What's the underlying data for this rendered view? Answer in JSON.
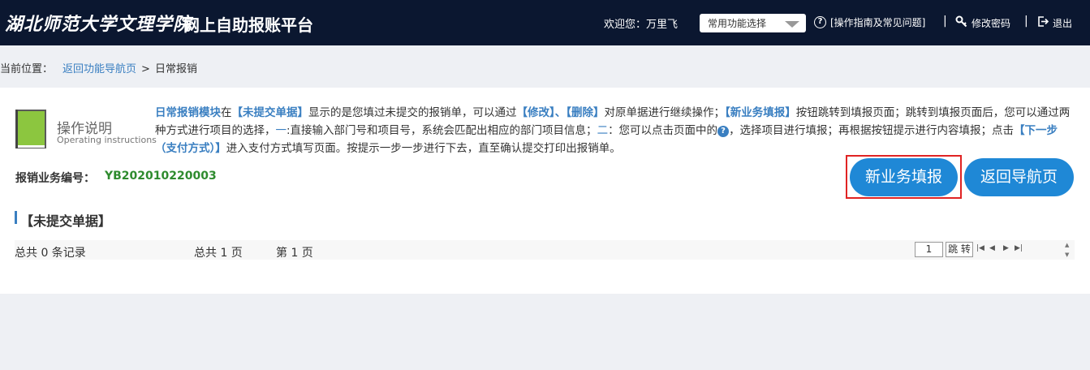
{
  "header": {
    "logo_text": "湖北师范大学文理学院",
    "platform_title": "网上自助报账平台",
    "welcome": "欢迎您：万里飞",
    "common_select": "常用功能选择",
    "help_link": "[操作指南及常见问题]",
    "change_password": "修改密码",
    "logout": "退出",
    "separator": "|"
  },
  "breadcrumb": {
    "label": "当前位置：",
    "link": "返回功能导航页",
    "separator": ">",
    "current": "日常报销"
  },
  "instructions": {
    "title": "操作说明",
    "subtitle": "Operating instructions",
    "p1": "日常报销模块",
    "p2": "在",
    "p3": "【未提交单据】",
    "p4": "显示的是您填过未提交的报销单，可以通过",
    "p5": "【修改】、【删除】",
    "p6": "对原单据进行继续操作；",
    "p7": "【新业务填报】",
    "p8": "按钮跳转到填报页面；跳转到填报页面后，您可以通过两种方式进行项目的选择，",
    "p9": "一",
    "p10": ":直接输入部门号和项目号，系统会匹配出相应的部门项目信息；",
    "p11": "二",
    "p12": "：您可以点击页面中的",
    "p13": "，选择项目进行填报；再根据按钮提示进行内容填报；点击",
    "p14": "【下一步（支付方式）】",
    "p15": "进入支付方式填写页面。按提示一步一步进行下去，直至确认提交打印出报销单。"
  },
  "serial": {
    "label": "报销业务编号：",
    "value": "YB202010220003"
  },
  "buttons": {
    "new_business": "新业务填报",
    "back_nav": "返回导航页"
  },
  "section": {
    "title": "【未提交单据】"
  },
  "pager": {
    "total_records": "总共  0  条记录",
    "total_pages": "总共   1 页",
    "current_page": "第  1 页",
    "page_input": "1",
    "jump_label": "跳 转"
  },
  "colors": {
    "header_bg": "#0b1730",
    "accent_blue": "#1f88d6",
    "link_blue": "#3a7fc1",
    "serial_green": "#2e8b2e",
    "highlight_red": "#e02323"
  },
  "icons": {
    "book": "book-icon",
    "help": "help-circle-icon",
    "key": "key-icon",
    "logout": "logout-icon",
    "question": "question-icon"
  }
}
